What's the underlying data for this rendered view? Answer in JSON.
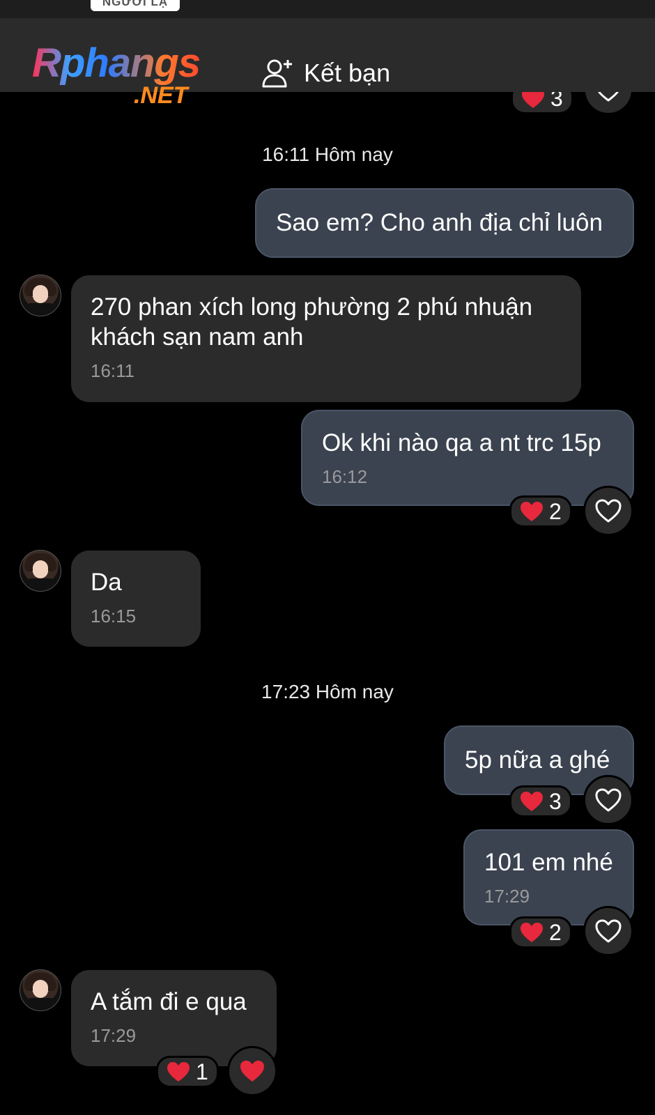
{
  "top": {
    "stranger_tag": "NGƯỜI LẠ"
  },
  "header": {
    "logo_main": "Rphangs",
    "logo_sub": ".NET",
    "add_friend_label": "Kết bạn"
  },
  "partial_top_reaction": {
    "count": "3"
  },
  "timestamps": [
    "16:11 Hôm nay",
    "17:23 Hôm nay"
  ],
  "messages": [
    {
      "side": "out",
      "text": "Sao em? Cho anh địa chỉ luôn",
      "time": ""
    },
    {
      "side": "in",
      "text_lines": [
        "270 phan xích long phường 2 phú nhuận",
        "khách sạn nam anh"
      ],
      "time": "16:11"
    },
    {
      "side": "out",
      "text": "Ok khi nào qa a nt trc 15p",
      "time": "16:12",
      "reaction_count": "2"
    },
    {
      "side": "in",
      "text": "Da",
      "time": "16:15"
    },
    {
      "side": "out",
      "text": "5p nữa a ghé",
      "time": "",
      "reaction_count": "3"
    },
    {
      "side": "out",
      "text": "101 em nhé",
      "time": "17:29",
      "reaction_count": "2"
    },
    {
      "side": "in",
      "text": "A tắm đi e qua",
      "time": "17:29",
      "reaction_count": "1"
    }
  ],
  "colors": {
    "background": "#000000",
    "header": "#2b2b2b",
    "outgoing_bubble": "#3b4350",
    "incoming_bubble": "#2b2b2b",
    "heart": "#e8283c"
  },
  "icons": {
    "add_friend": "person-plus-icon",
    "reaction": "heart-filled-icon",
    "like": "heart-outline-icon"
  }
}
